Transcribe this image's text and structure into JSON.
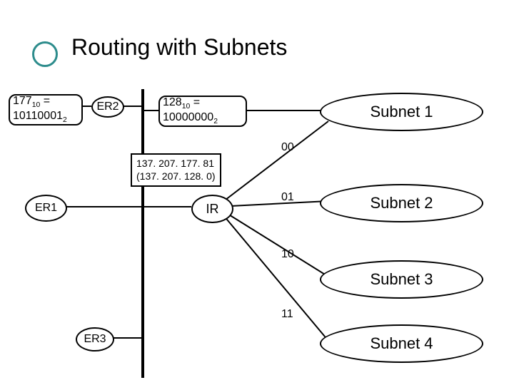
{
  "title": "Routing with Subnets",
  "nodes": {
    "val177": {
      "dec": "177",
      "sub1": "10",
      "bin": "10110001",
      "sub2": "2"
    },
    "er2": "ER2",
    "val128": {
      "dec": "128",
      "sub1": "10",
      "bin": "10000000",
      "sub2": "2"
    },
    "subnet1": "Subnet 1",
    "ipbox": {
      "line1": "137. 207. 177. 81",
      "line2": "(137. 207. 128. 0)"
    },
    "er1": "ER1",
    "ir": "IR",
    "subnet2": "Subnet 2",
    "subnet3": "Subnet 3",
    "er3": "ER3",
    "subnet4": "Subnet 4"
  },
  "bits": {
    "b00": "00",
    "b01": "01",
    "b10": "10",
    "b11": "11"
  }
}
